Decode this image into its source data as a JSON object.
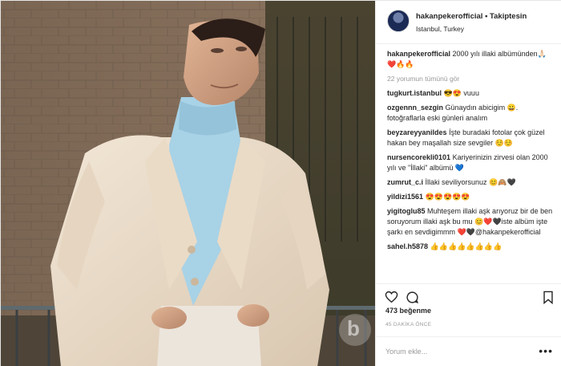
{
  "header": {
    "username": "hakanpekerofficial",
    "separator": "•",
    "follow_label": "Takiptesin",
    "location": "Istanbul, Turkey"
  },
  "caption": {
    "username": "hakanpekerofficial",
    "text": "2000 yılı illaki albümünden🙏🏻❤️🔥🔥"
  },
  "view_all_comments": "22 yorumun tümünü gör",
  "comments": [
    {
      "user": "tugkurt.istanbul",
      "text": "😎😍 vuuu"
    },
    {
      "user": "ozgennn_sezgin",
      "text": "Günaydın abicigim 😀. fotoğraflarla eski günleri analım"
    },
    {
      "user": "beyzareyyanildes",
      "text": "İşte buradaki fotolar çok güzel hakan bey maşallah size sevgiler ☺️☺️"
    },
    {
      "user": "nursencorekli0101",
      "text": "Kariyerinizin zirvesi olan 2000 yılı ve \"İllaki\" albümü 💙"
    },
    {
      "user": "zumrut_c.i",
      "text": "İllaki seviliyorsunuz 😊🙈🖤"
    },
    {
      "user": "yildizi1561",
      "text": "😍😍😍😍😍"
    },
    {
      "user": "yigitoglu85",
      "text": "Muhteşem illaki aşk arıyoruz bir de ben soruyorum illaki aşk bu mu 😊❤️🖤iste albüm işte şarkı en sevdigimmm ❤️🖤@hakanpekerofficial"
    },
    {
      "user": "sahel.h5878",
      "text": "👍👍👍👍👍👍👍👍"
    }
  ],
  "likes": "473 beğenme",
  "time": "45 DAKİKA ÖNCE",
  "add_comment_placeholder": "Yorum ekle...",
  "more_options": "•••",
  "watermark": "b"
}
